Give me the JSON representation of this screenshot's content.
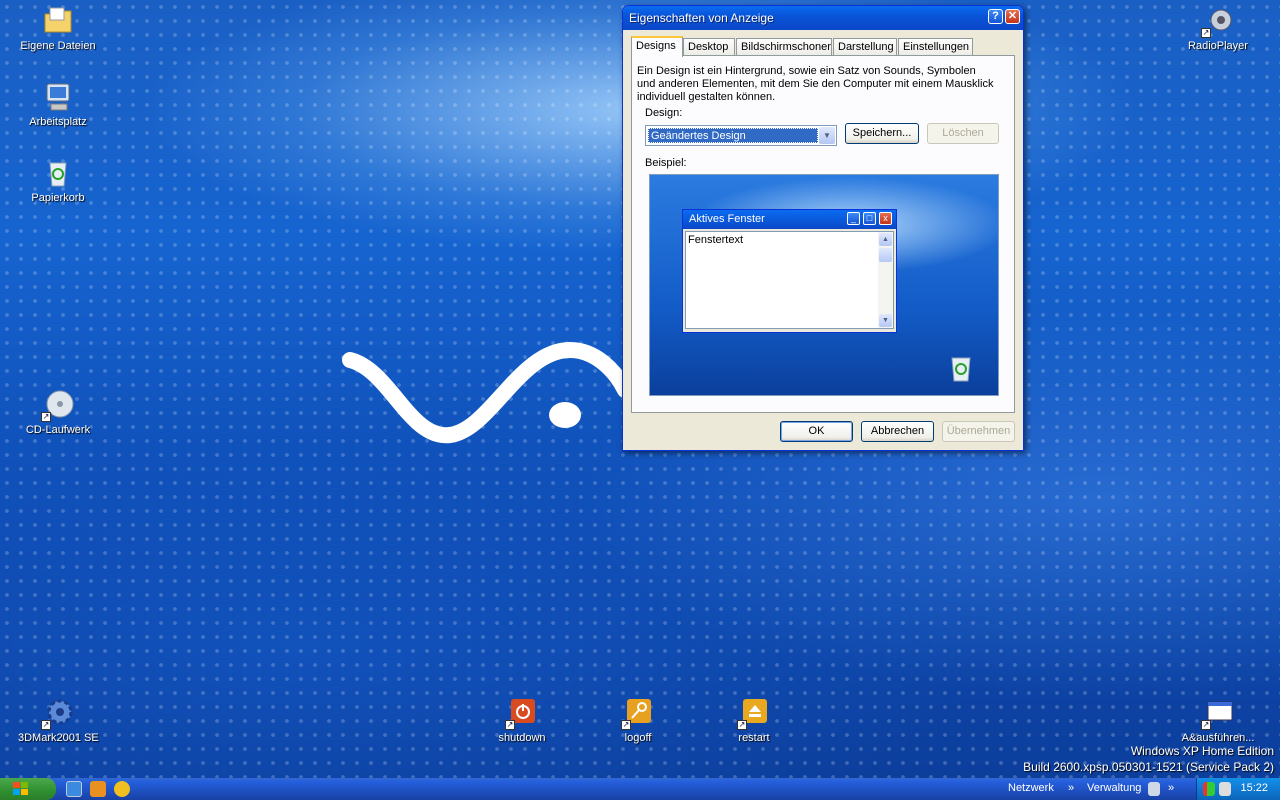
{
  "desktop": {
    "icons": [
      {
        "label": "Eigene Dateien",
        "icon": "my-documents-icon"
      },
      {
        "label": "Arbeitsplatz",
        "icon": "my-computer-icon"
      },
      {
        "label": "Papierkorb",
        "icon": "recycle-bin-icon"
      },
      {
        "label": "CD-Laufwerk",
        "icon": "cd-drive-icon"
      },
      {
        "label": "RadioPlayer",
        "icon": "radio-player-icon"
      },
      {
        "label": "3DMark2001 SE",
        "icon": "gear-icon"
      },
      {
        "label": "shutdown",
        "icon": "power-icon"
      },
      {
        "label": "logoff",
        "icon": "key-icon"
      },
      {
        "label": "restart",
        "icon": "eject-icon"
      },
      {
        "label": "A&ausführen...",
        "icon": "run-icon"
      }
    ],
    "os_info": {
      "line1": "Windows XP Home Edition",
      "line2": "Build 2600.xpsp.050301-1521 (Service Pack 2)"
    }
  },
  "dialog": {
    "title": "Eigenschaften von Anzeige",
    "help_btn": "?",
    "close_btn": "✕",
    "tabs": [
      "Designs",
      "Desktop",
      "Bildschirmschoner",
      "Darstellung",
      "Einstellungen"
    ],
    "active_tab": "Designs",
    "description": "Ein Design ist ein Hintergrund, sowie ein Satz von Sounds, Symbolen und anderen Elementen, mit dem Sie den Computer mit einem Mausklick individuell gestalten können.",
    "design_label": "Design:",
    "design_value": "Geändertes Design",
    "save_button": "Speichern...",
    "delete_button": "Löschen",
    "example_label": "Beispiel:",
    "preview": {
      "window_title": "Aktives Fenster",
      "window_text": "Fenstertext"
    },
    "ok_button": "OK",
    "cancel_button": "Abbrechen",
    "apply_button": "Übernehmen"
  },
  "taskbar": {
    "start_label": "",
    "toolbar_netzwerk": "Netzwerk",
    "toolbar_verwaltung": "Verwaltung",
    "chevron": "»",
    "clock": "15:22"
  }
}
